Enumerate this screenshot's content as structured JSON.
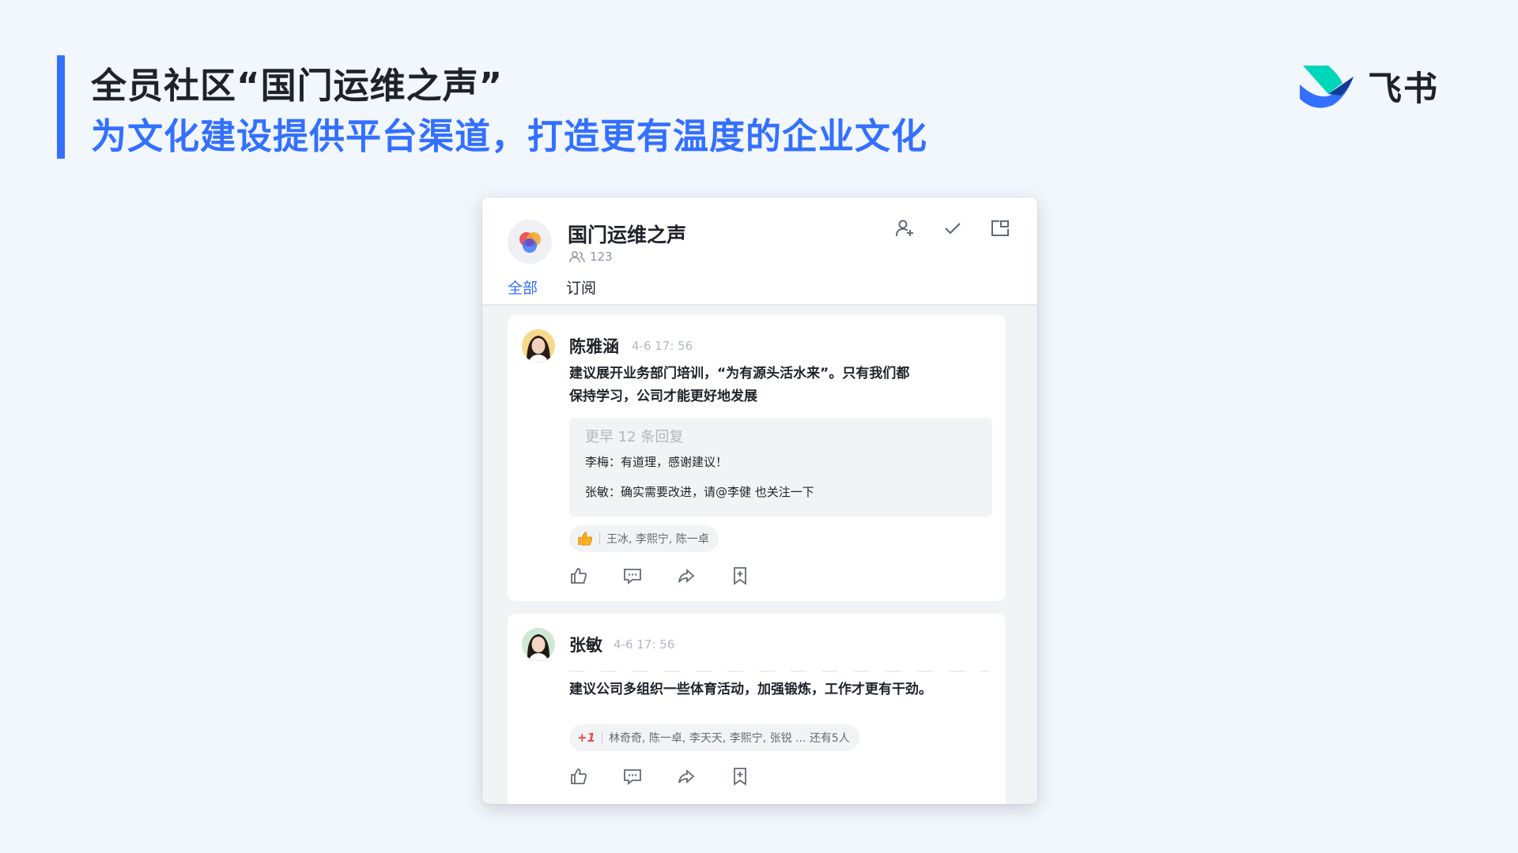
{
  "slide": {
    "title": "全员社区“国门运维之声”",
    "subtitle": "为文化建设提供平台渠道，打造更有温度的企业文化",
    "brand_name": "飞书",
    "accent_color": "#3370ff"
  },
  "group": {
    "name": "国门运维之声",
    "member_count": "123",
    "header_icons": [
      "add-member-icon",
      "check-icon",
      "share-window-icon"
    ]
  },
  "tabs": [
    {
      "label": "全部",
      "active": true
    },
    {
      "label": "订阅",
      "active": false
    }
  ],
  "posts": [
    {
      "author": "陈雅涵",
      "time": "4-6 17: 56",
      "content_line1": "建议展开业务部门培训，“为有源头活水来”。只有我们都",
      "content_line2": "保持学习，公司才能更好地发展",
      "earlier_replies": "更早 12 条回复",
      "replies": [
        {
          "text": "李梅：有道理，感谢建议！"
        },
        {
          "text": "张敏：确实需要改进，请@李健 也关注一下"
        }
      ],
      "reaction_emoji": "thumbs-up-icon",
      "reaction_users": "王冰, 李熙宁, 陈一卓"
    },
    {
      "author": "张敏",
      "time": "4-6 17: 56",
      "content_line1": "建议公司多组织一些体育活动，加强锻炼，工作才更有干劲。",
      "reaction_emoji": "plus-one-icon",
      "reaction_label": "+1",
      "reaction_users": "林奇奇, 陈一卓, 李天天, 李熙宁, 张锐  ... 还有5人"
    }
  ],
  "post_actions": [
    "like-icon",
    "comment-icon",
    "forward-icon",
    "bookmark-icon"
  ]
}
